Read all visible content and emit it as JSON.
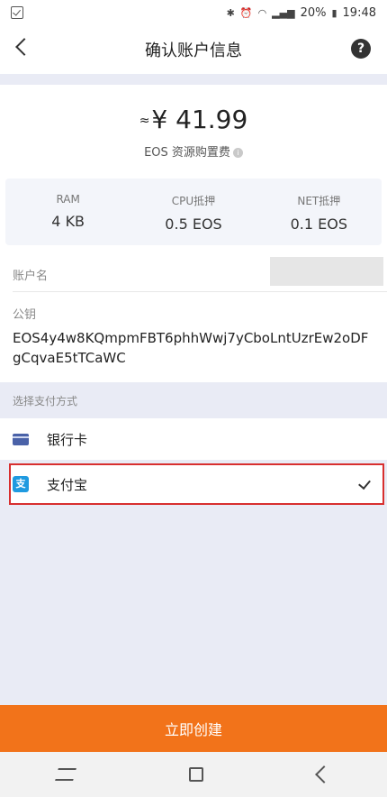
{
  "status_bar": {
    "battery": "20%",
    "time": "19:48"
  },
  "nav": {
    "title": "确认账户信息",
    "help_icon": "help-icon"
  },
  "price": {
    "approx": "≈",
    "amount": "¥ 41.99",
    "label": "EOS 资源购置费"
  },
  "resources": [
    {
      "label": "RAM",
      "value": "4 KB"
    },
    {
      "label": "CPU抵押",
      "value": "0.5 EOS"
    },
    {
      "label": "NET抵押",
      "value": "0.1 EOS"
    }
  ],
  "account": {
    "label": "账户名",
    "value": ""
  },
  "pubkey": {
    "label": "公钥",
    "value": "EOS4y4w8KQmpmFBT6phhWwj7yCboLntUzrEw2oDFgCqvaE5tTCaWC"
  },
  "payment": {
    "header": "选择支付方式",
    "options": [
      {
        "label": "银行卡",
        "icon": "bank-card-icon",
        "selected": false
      },
      {
        "label": "支付宝",
        "icon": "alipay-icon",
        "selected": true
      }
    ]
  },
  "create_button": "立即创建"
}
